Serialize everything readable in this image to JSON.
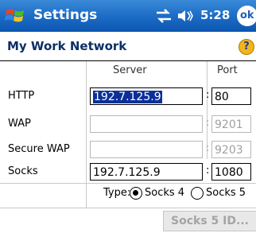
{
  "titlebar": {
    "app_title": "Settings",
    "clock": "5:28",
    "ok_label": "ok",
    "icons": [
      "windows-start-icon",
      "connectivity-icon",
      "volume-icon"
    ]
  },
  "page": {
    "title": "My Work Network",
    "help_label": "?"
  },
  "form": {
    "columns": {
      "server": "Server",
      "port": "Port"
    },
    "rows": [
      {
        "label": "HTTP",
        "server": "192.7.125.9",
        "port": "80",
        "enabled": true,
        "server_selected": true
      },
      {
        "label": "WAP",
        "server": "",
        "port": "9201",
        "enabled": false
      },
      {
        "label": "Secure WAP",
        "server": "",
        "port": "9203",
        "enabled": false
      },
      {
        "label": "Socks",
        "server": "192.7.125.9",
        "port": "1080",
        "enabled": true
      }
    ],
    "separator": ":",
    "type_label": "Type:",
    "socks_options": [
      "Socks 4",
      "Socks 5"
    ],
    "socks_selected": "Socks 4",
    "socks5_button_label": "Socks 5 ID..."
  },
  "colors": {
    "titlebar": "#1f6fc8",
    "selection": "#0b2f9a",
    "page_title": "#0b2f66",
    "disabled_text": "#a0a0a0"
  }
}
